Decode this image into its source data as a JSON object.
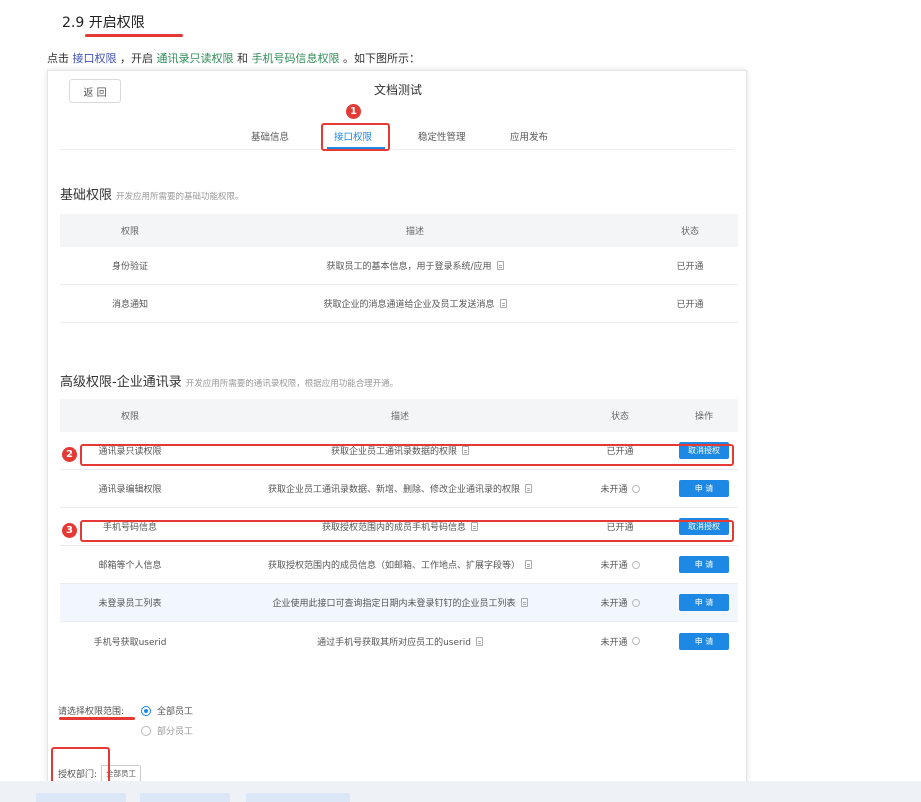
{
  "heading": {
    "number": "2.9",
    "title": "开启权限"
  },
  "intro": {
    "prefix": "点击",
    "link_interface": "接口权限",
    "middle": "，开启",
    "link_readonly": "通讯录只读权限",
    "and": "和",
    "link_phone": "手机号码信息权限",
    "suffix": "。如下图所示："
  },
  "app": {
    "back_label": "返 回",
    "title": "文档测试",
    "tabs": [
      "基础信息",
      "接口权限",
      "稳定性管理",
      "应用发布"
    ],
    "active_tab_index": 1
  },
  "basic": {
    "title": "基础权限",
    "desc": "开发应用所需要的基础功能权限。",
    "headers": [
      "权限",
      "描述",
      "状态"
    ],
    "rows": [
      {
        "name": "身份验证",
        "desc": "获取员工的基本信息，用于登录系统/应用",
        "status": "已开通"
      },
      {
        "name": "消息通知",
        "desc": "获取企业的消息通道给企业及员工发送消息",
        "status": "已开通"
      }
    ]
  },
  "advanced": {
    "title": "高级权限-企业通讯录",
    "desc": "开发应用所需要的通讯录权限，根据应用功能合理开通。",
    "headers": [
      "权限",
      "描述",
      "状态",
      "操作"
    ],
    "rows": [
      {
        "name": "通讯录只读权限",
        "desc": "获取企业员工通讯录数据的权限",
        "status": "已开通",
        "action": "取消授权"
      },
      {
        "name": "通讯录编辑权限",
        "desc": "获取企业员工通讯录数据、新增、删除、修改企业通讯录的权限",
        "status": "未开通",
        "action": "申 请"
      },
      {
        "name": "手机号码信息",
        "desc": "获取授权范围内的成员手机号码信息",
        "status": "已开通",
        "action": "取消授权"
      },
      {
        "name": "邮箱等个人信息",
        "desc": "获取授权范围内的成员信息（如邮箱、工作地点、扩展字段等）",
        "status": "未开通",
        "action": "申 请"
      },
      {
        "name": "未登录员工列表",
        "desc": "企业使用此接口可查询指定日期内未登录钉钉的企业员工列表",
        "status": "未开通",
        "action": "申 请"
      },
      {
        "name": "手机号获取userid",
        "desc": "通过手机号获取其所对应员工的userid",
        "status": "未开通",
        "action": "申 请"
      }
    ]
  },
  "scope": {
    "label": "请选择权限范围:",
    "options": [
      "全部员工",
      "部分员工"
    ],
    "selected_index": 0
  },
  "dept": {
    "label": "授权部门:",
    "tag": "全部员工"
  },
  "badges": [
    "1",
    "2",
    "3"
  ],
  "colors": {
    "accent": "#1e88e5",
    "annotation_red": "#e53935",
    "green_link": "#2e8b57",
    "purple_link": "#3f51b5"
  }
}
